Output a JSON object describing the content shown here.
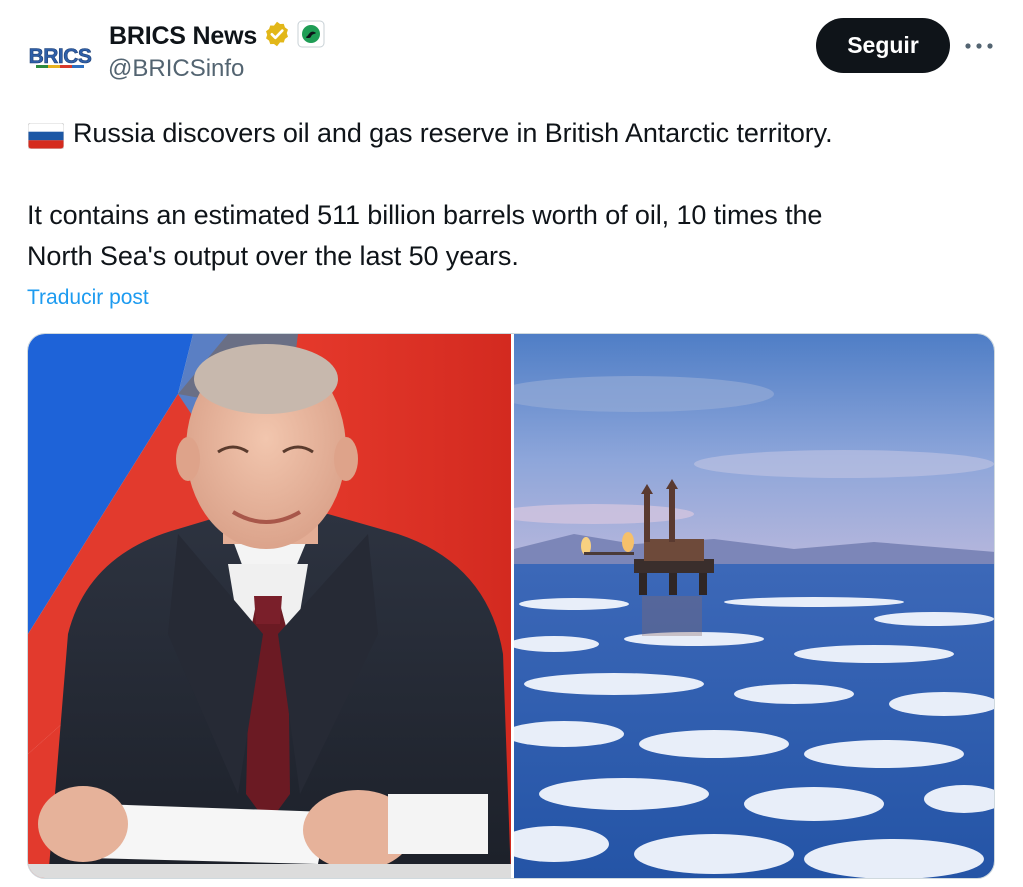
{
  "account": {
    "display_name": "BRICS News",
    "handle": "@BRICSinfo",
    "avatar_text": "BRICS",
    "verified_icon": "gold-verified-badge",
    "affiliate_icon": "affiliate-badge"
  },
  "actions": {
    "follow_label": "Seguir",
    "more_icon": "more-horizontal-icon"
  },
  "tweet": {
    "flag_icon": "russia-flag",
    "line1": "Russia discovers oil and gas reserve in British Antarctic territory.",
    "line2": "It contains an estimated 511 billion barrels worth of oil, 10 times the",
    "line3": "North Sea's output over the last 50 years.",
    "translate_label": "Traducir post"
  },
  "media": {
    "items": [
      {
        "description_icon": "photo-man-in-suit-before-flags"
      },
      {
        "description_icon": "photo-oil-rig-in-icy-sea"
      }
    ]
  },
  "colors": {
    "follow_bg": "#0f1419",
    "link": "#1d9bf0",
    "secondary_text": "#536471",
    "verified_gold": "#e2b719"
  }
}
